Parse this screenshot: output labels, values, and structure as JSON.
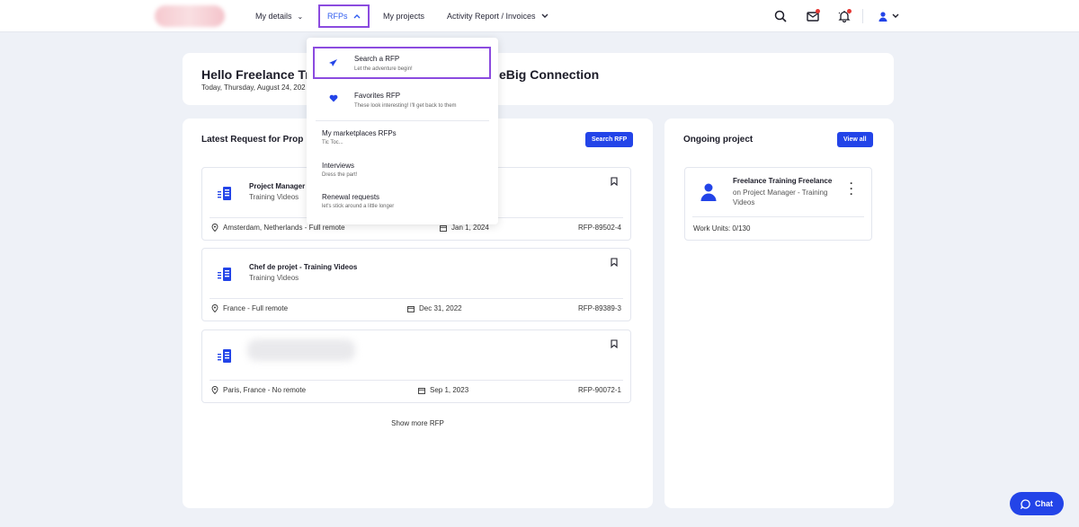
{
  "colors": {
    "accent": "#2344e8",
    "highlight": "#8b4bdf",
    "background": "#eef1f7",
    "notification": "#e53935"
  },
  "nav": {
    "items": [
      {
        "label": "My details",
        "icon": "chevron-down-icon"
      },
      {
        "label": "RFPs",
        "icon": "chevron-up-icon"
      },
      {
        "label": "My projects"
      },
      {
        "label": "Activity Report / Invoices",
        "icon": "chevron-down-icon"
      }
    ],
    "icons": [
      "search-icon",
      "mail-icon",
      "bell-icon",
      "user-icon"
    ]
  },
  "rfp_menu": {
    "items": [
      {
        "label": "Search a RFP",
        "desc": "Let the adventure begin!",
        "icon": "paper-plane-icon"
      },
      {
        "label": "Favorites RFP",
        "desc": "These look interesting! I'll get back to them",
        "icon": "heart-icon"
      },
      {
        "label": "My marketplaces RFPs",
        "desc": "Tic Toc..."
      },
      {
        "label": "Interviews",
        "desc": "Dress the part!"
      },
      {
        "label": "Renewal requests",
        "desc": "let's stick around a little longer"
      }
    ]
  },
  "welcome": {
    "title_start": "Hello Freelance Tra",
    "title_end": "eBig Connection",
    "date": "Today, Thursday, August 24, 202"
  },
  "latest": {
    "title": "Latest Request for Prop",
    "button": "Search RFP",
    "items": [
      {
        "title": "Project Manager",
        "subtitle": "Training Videos",
        "location": "Amsterdam, Netherlands - Full remote",
        "date": "Jan 1, 2024",
        "ref": "RFP-89502-4"
      },
      {
        "title": "Chef de projet - Training Videos",
        "subtitle": "Training Videos",
        "location": "France - Full remote",
        "date": "Dec 31, 2022",
        "ref": "RFP-89389-3"
      },
      {
        "title": "",
        "subtitle": "",
        "location": "Paris, France - No remote",
        "date": "Sep 1, 2023",
        "ref": "RFP-90072-1"
      }
    ],
    "show_more": "Show more RFP"
  },
  "ongoing": {
    "title": "Ongoing project",
    "button": "View all",
    "project": {
      "title": "Freelance Training Freelance",
      "subtitle": "on Project Manager - Training Videos",
      "units": "Work Units: 0/130"
    }
  },
  "chat": {
    "label": "Chat"
  }
}
